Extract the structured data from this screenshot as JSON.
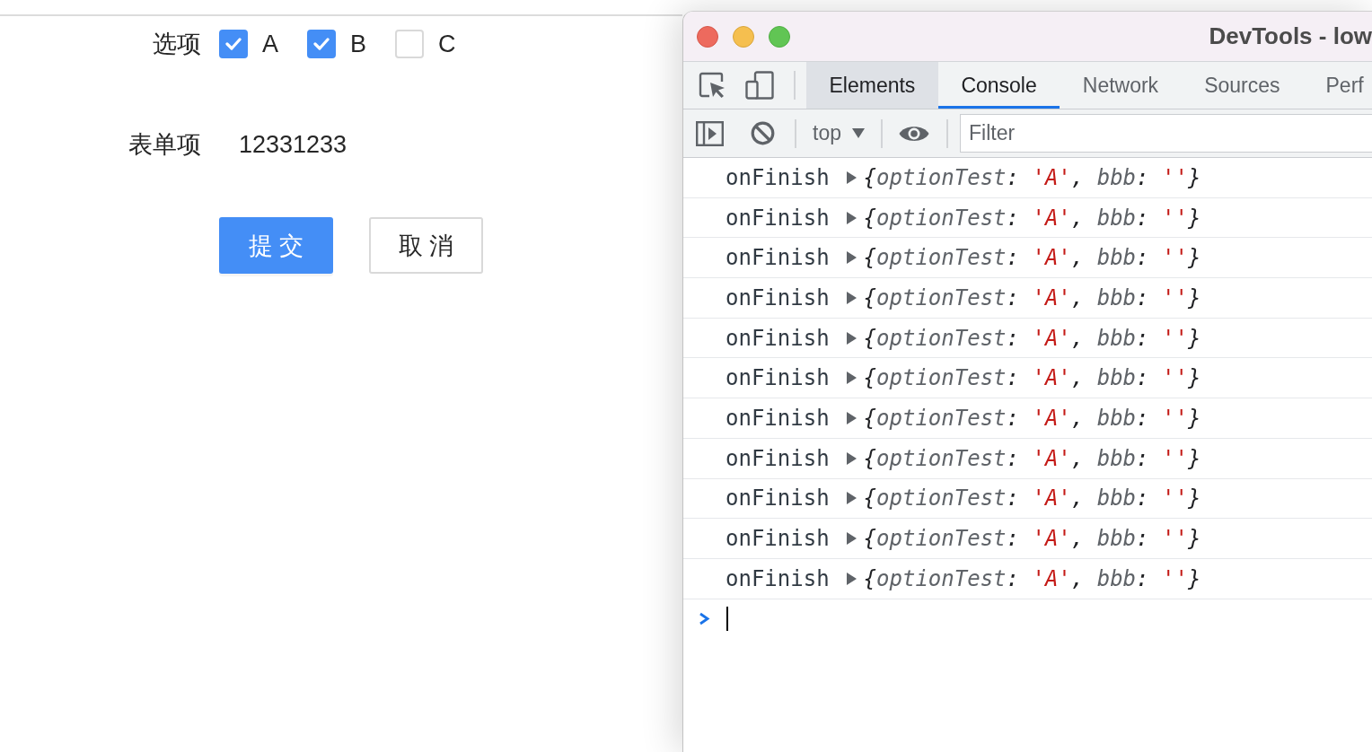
{
  "page": {
    "options_label": "选项",
    "options": [
      {
        "label": "A",
        "checked": true
      },
      {
        "label": "B",
        "checked": true
      },
      {
        "label": "C",
        "checked": false
      }
    ],
    "field_label": "表单项",
    "field_value": "12331233",
    "buttons": [
      {
        "label": "提 交",
        "kind": "primary"
      },
      {
        "label": "取 消",
        "kind": "default"
      }
    ]
  },
  "devtools": {
    "title": "DevTools - low",
    "tabs": [
      {
        "label": "Elements",
        "selected": false,
        "highlighted": true
      },
      {
        "label": "Console",
        "selected": true,
        "highlighted": false
      },
      {
        "label": "Network",
        "selected": false,
        "highlighted": false
      },
      {
        "label": "Sources",
        "selected": false,
        "highlighted": false
      },
      {
        "label": "Perf",
        "selected": false,
        "highlighted": false
      }
    ],
    "context": "top",
    "filter": {
      "placeholder": "Filter"
    },
    "messages": [
      {
        "label": "onFinish",
        "expanded": false,
        "preview": [
          {
            "kind": "punct",
            "text": "{"
          },
          {
            "kind": "key",
            "text": "optionTest"
          },
          {
            "kind": "punct",
            "text": ": "
          },
          {
            "kind": "string",
            "text": "'A'"
          },
          {
            "kind": "punct",
            "text": ", "
          },
          {
            "kind": "key",
            "text": "bbb"
          },
          {
            "kind": "punct",
            "text": ": "
          },
          {
            "kind": "string",
            "text": "''"
          },
          {
            "kind": "punct",
            "text": "}"
          }
        ]
      },
      {
        "label": "onFinish",
        "expanded": false,
        "preview": [
          {
            "kind": "punct",
            "text": "{"
          },
          {
            "kind": "key",
            "text": "optionTest"
          },
          {
            "kind": "punct",
            "text": ": "
          },
          {
            "kind": "string",
            "text": "'A'"
          },
          {
            "kind": "punct",
            "text": ", "
          },
          {
            "kind": "key",
            "text": "bbb"
          },
          {
            "kind": "punct",
            "text": ": "
          },
          {
            "kind": "string",
            "text": "''"
          },
          {
            "kind": "punct",
            "text": "}"
          }
        ]
      },
      {
        "label": "onFinish",
        "expanded": false,
        "preview": [
          {
            "kind": "punct",
            "text": "{"
          },
          {
            "kind": "key",
            "text": "optionTest"
          },
          {
            "kind": "punct",
            "text": ": "
          },
          {
            "kind": "string",
            "text": "'A'"
          },
          {
            "kind": "punct",
            "text": ", "
          },
          {
            "kind": "key",
            "text": "bbb"
          },
          {
            "kind": "punct",
            "text": ": "
          },
          {
            "kind": "string",
            "text": "''"
          },
          {
            "kind": "punct",
            "text": "}"
          }
        ]
      },
      {
        "label": "onFinish",
        "expanded": false,
        "preview": [
          {
            "kind": "punct",
            "text": "{"
          },
          {
            "kind": "key",
            "text": "optionTest"
          },
          {
            "kind": "punct",
            "text": ": "
          },
          {
            "kind": "string",
            "text": "'A'"
          },
          {
            "kind": "punct",
            "text": ", "
          },
          {
            "kind": "key",
            "text": "bbb"
          },
          {
            "kind": "punct",
            "text": ": "
          },
          {
            "kind": "string",
            "text": "''"
          },
          {
            "kind": "punct",
            "text": "}"
          }
        ]
      },
      {
        "label": "onFinish",
        "expanded": false,
        "preview": [
          {
            "kind": "punct",
            "text": "{"
          },
          {
            "kind": "key",
            "text": "optionTest"
          },
          {
            "kind": "punct",
            "text": ": "
          },
          {
            "kind": "string",
            "text": "'A'"
          },
          {
            "kind": "punct",
            "text": ", "
          },
          {
            "kind": "key",
            "text": "bbb"
          },
          {
            "kind": "punct",
            "text": ": "
          },
          {
            "kind": "string",
            "text": "''"
          },
          {
            "kind": "punct",
            "text": "}"
          }
        ]
      },
      {
        "label": "onFinish",
        "expanded": false,
        "preview": [
          {
            "kind": "punct",
            "text": "{"
          },
          {
            "kind": "key",
            "text": "optionTest"
          },
          {
            "kind": "punct",
            "text": ": "
          },
          {
            "kind": "string",
            "text": "'A'"
          },
          {
            "kind": "punct",
            "text": ", "
          },
          {
            "kind": "key",
            "text": "bbb"
          },
          {
            "kind": "punct",
            "text": ": "
          },
          {
            "kind": "string",
            "text": "''"
          },
          {
            "kind": "punct",
            "text": "}"
          }
        ]
      },
      {
        "label": "onFinish",
        "expanded": false,
        "preview": [
          {
            "kind": "punct",
            "text": "{"
          },
          {
            "kind": "key",
            "text": "optionTest"
          },
          {
            "kind": "punct",
            "text": ": "
          },
          {
            "kind": "string",
            "text": "'A'"
          },
          {
            "kind": "punct",
            "text": ", "
          },
          {
            "kind": "key",
            "text": "bbb"
          },
          {
            "kind": "punct",
            "text": ": "
          },
          {
            "kind": "string",
            "text": "''"
          },
          {
            "kind": "punct",
            "text": "}"
          }
        ]
      },
      {
        "label": "onFinish",
        "expanded": false,
        "preview": [
          {
            "kind": "punct",
            "text": "{"
          },
          {
            "kind": "key",
            "text": "optionTest"
          },
          {
            "kind": "punct",
            "text": ": "
          },
          {
            "kind": "string",
            "text": "'A'"
          },
          {
            "kind": "punct",
            "text": ", "
          },
          {
            "kind": "key",
            "text": "bbb"
          },
          {
            "kind": "punct",
            "text": ": "
          },
          {
            "kind": "string",
            "text": "''"
          },
          {
            "kind": "punct",
            "text": "}"
          }
        ]
      },
      {
        "label": "onFinish",
        "expanded": false,
        "preview": [
          {
            "kind": "punct",
            "text": "{"
          },
          {
            "kind": "key",
            "text": "optionTest"
          },
          {
            "kind": "punct",
            "text": ": "
          },
          {
            "kind": "string",
            "text": "'A'"
          },
          {
            "kind": "punct",
            "text": ", "
          },
          {
            "kind": "key",
            "text": "bbb"
          },
          {
            "kind": "punct",
            "text": ": "
          },
          {
            "kind": "string",
            "text": "''"
          },
          {
            "kind": "punct",
            "text": "}"
          }
        ]
      },
      {
        "label": "onFinish",
        "expanded": false,
        "preview": [
          {
            "kind": "punct",
            "text": "{"
          },
          {
            "kind": "key",
            "text": "optionTest"
          },
          {
            "kind": "punct",
            "text": ": "
          },
          {
            "kind": "string",
            "text": "'A'"
          },
          {
            "kind": "punct",
            "text": ", "
          },
          {
            "kind": "key",
            "text": "bbb"
          },
          {
            "kind": "punct",
            "text": ": "
          },
          {
            "kind": "string",
            "text": "''"
          },
          {
            "kind": "punct",
            "text": "}"
          }
        ]
      },
      {
        "label": "onFinish",
        "expanded": false,
        "preview": [
          {
            "kind": "punct",
            "text": "{"
          },
          {
            "kind": "key",
            "text": "optionTest"
          },
          {
            "kind": "punct",
            "text": ": "
          },
          {
            "kind": "string",
            "text": "'A'"
          },
          {
            "kind": "punct",
            "text": ", "
          },
          {
            "kind": "key",
            "text": "bbb"
          },
          {
            "kind": "punct",
            "text": ": "
          },
          {
            "kind": "string",
            "text": "''"
          },
          {
            "kind": "punct",
            "text": "}"
          }
        ]
      }
    ]
  }
}
